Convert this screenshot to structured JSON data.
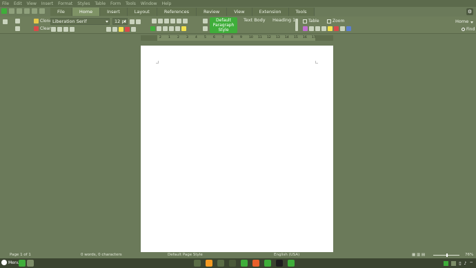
{
  "menu": [
    "File",
    "Edit",
    "View",
    "Insert",
    "Format",
    "Styles",
    "Table",
    "Form",
    "Tools",
    "Window",
    "Help"
  ],
  "tabs": [
    {
      "label": "File"
    },
    {
      "label": "Home"
    },
    {
      "label": "Insert"
    },
    {
      "label": "Layout"
    },
    {
      "label": "References"
    },
    {
      "label": "Review"
    },
    {
      "label": "View"
    },
    {
      "label": "Extension"
    },
    {
      "label": "Tools"
    }
  ],
  "active_tab": "Home",
  "ribbon": {
    "clone_label": "Clone",
    "clear_label": "Clear",
    "font_name": "Liberation Serif",
    "font_size": "12 pt",
    "styles": {
      "default": "Default Paragraph Style",
      "text_body": "Text Body",
      "heading1": "Heading 1"
    },
    "table_label": "Table",
    "zoom_label": "Zoom",
    "find_label": "Find",
    "home_label": "Home"
  },
  "ruler": {
    "ticks": [
      "1",
      "2",
      "1",
      "2",
      "3",
      "4",
      "5",
      "6",
      "7",
      "8",
      "9",
      "10",
      "11",
      "12",
      "13",
      "14",
      "15",
      "16",
      "17",
      "18"
    ]
  },
  "status": {
    "page": "Page 1 of 1",
    "words": "0 words, 0 characters",
    "page_style": "Default Page Style",
    "language": "English (USA)",
    "zoom": "76%"
  },
  "taskbar": {
    "menu_label": "Menu",
    "apps": [
      {
        "name": "files",
        "color": "#5b6d46"
      },
      {
        "name": "media",
        "color": "#f59a23"
      },
      {
        "name": "home-folder",
        "color": "#5b6d46"
      },
      {
        "name": "app",
        "color": "#4b5a3a"
      },
      {
        "name": "writer",
        "color": "#3fae3a"
      },
      {
        "name": "firefox",
        "color": "#e8602a"
      },
      {
        "name": "terminal-green",
        "color": "#3fae3a"
      },
      {
        "name": "terminal",
        "color": "#1e1e1e"
      },
      {
        "name": "vim",
        "color": "#3fae3a"
      }
    ]
  }
}
